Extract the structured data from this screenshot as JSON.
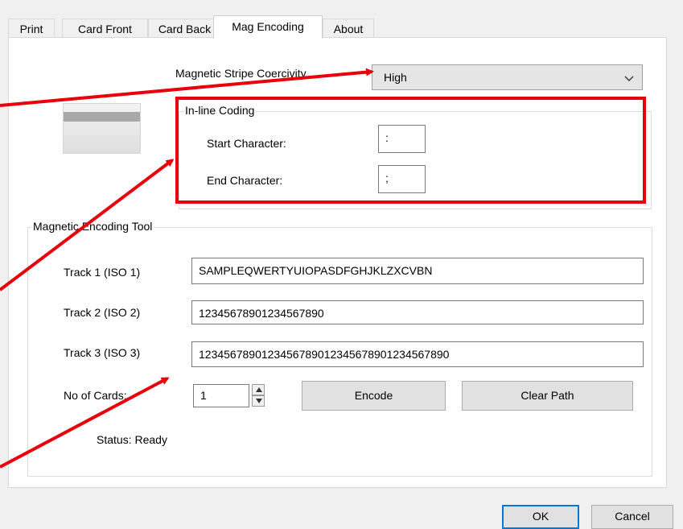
{
  "tabs": [
    {
      "label": "Print",
      "active": false
    },
    {
      "label": "Card Front",
      "active": false
    },
    {
      "label": "Card Back",
      "active": false
    },
    {
      "label": "Mag Encoding",
      "active": true
    },
    {
      "label": "About",
      "active": false
    }
  ],
  "coercivity": {
    "label": "Magnetic Stripe Coercivity",
    "selected": "High"
  },
  "inline_coding": {
    "title": "In-line Coding",
    "start_label": "Start Character:",
    "start_value": ":",
    "end_label": "End Character:",
    "end_value": ";"
  },
  "encoding_tool": {
    "title": "Magnetic Encoding Tool",
    "track1_label": "Track 1 (ISO 1)",
    "track1_value": "SAMPLEQWERTYUIOPASDFGHJKLZXCVBN",
    "track2_label": "Track 2 (ISO 2)",
    "track2_value": "12345678901234567890",
    "track3_label": "Track 3 (ISO 3)",
    "track3_value": "1234567890123456789012345678901234567890",
    "cards_label": "No of Cards:",
    "cards_value": "1",
    "encode_label": "Encode",
    "clear_label": "Clear Path",
    "status": "Status: Ready"
  },
  "footer": {
    "ok_label": "OK",
    "cancel_label": "Cancel"
  },
  "colors": {
    "annotation": "#e8000c",
    "accent": "#0078d7"
  },
  "icons": {
    "dropdown": "chevron-down-icon",
    "spin_up": "triangle-up-icon",
    "spin_down": "triangle-down-icon"
  }
}
